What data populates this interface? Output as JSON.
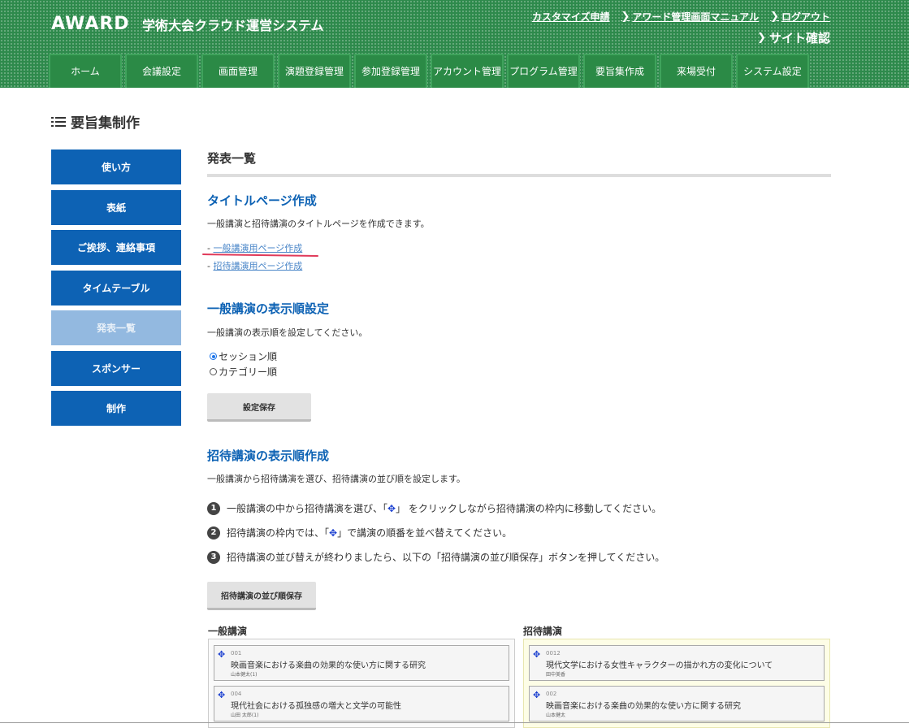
{
  "header": {
    "logo": "AWARD",
    "system_title": "学術大会クラウド運営システム",
    "links": [
      "カスタマイズ申請",
      "アワード管理画面マニュアル",
      "ログアウト"
    ],
    "site_check": "サイト確認",
    "nav": [
      "ホーム",
      "会議設定",
      "画面管理",
      "演題登録管理",
      "参加登録管理",
      "アカウント管理",
      "プログラム管理",
      "要旨集作成",
      "来場受付",
      "システム設定"
    ]
  },
  "page_title": "要旨集制作",
  "sidebar": {
    "items": [
      "使い方",
      "表紙",
      "ご挨拶、連絡事項",
      "タイムテーブル",
      "発表一覧",
      "スポンサー",
      "制作"
    ],
    "active": "発表一覧"
  },
  "main": {
    "section_title": "発表一覧",
    "title_page": {
      "heading": "タイトルページ作成",
      "desc": "一般講演と招待講演のタイトルページを作成できます。",
      "links": [
        "一般講演用ページ作成",
        "招待講演用ページ作成"
      ]
    },
    "order_setting": {
      "heading": "一般講演の表示順設定",
      "desc": "一般講演の表示順を設定してください。",
      "options": [
        "セッション順",
        "カテゴリー順"
      ],
      "selected": "セッション順",
      "save_button": "設定保存"
    },
    "invited": {
      "heading": "招待講演の表示順作成",
      "desc": "一般講演から招待講演を選び、招待講演の並び順を設定します。",
      "steps": [
        {
          "num": "1",
          "before": "一般講演の中から招待講演を選び、「",
          "after": "」 をクリックしながら招待講演の枠内に移動してください。"
        },
        {
          "num": "2",
          "before": "招待講演の枠内では、「",
          "after": "」で講演の順番を並べ替えてください。"
        },
        {
          "num": "3",
          "before": "招待講演の並び替えが終わりましたら、以下の「招待講演の並び順保存」ボタンを押してください。",
          "after": ""
        }
      ],
      "save_button": "招待講演の並び順保存",
      "general_heading": "一般講演",
      "invited_heading": "招待講演",
      "general_list": [
        {
          "id": "001",
          "title": "映画音楽における楽曲の効果的な使い方に関する研究",
          "author": "山本健太(1)"
        },
        {
          "id": "004",
          "title": "現代社会における孤独感の増大と文学の可能性",
          "author": "山田 太郎(1)"
        }
      ],
      "invited_list": [
        {
          "id": "0012",
          "title": "現代文学における女性キャラクターの描かれ方の変化について",
          "author": "田中美香"
        },
        {
          "id": "002",
          "title": "映画音楽における楽曲の効果的な使い方に関する研究",
          "author": "山本健太"
        }
      ]
    }
  },
  "colors": {
    "header_green": "#2e8a4c",
    "sidebar_blue": "#0d62b4",
    "sidebar_active": "#93b9e0",
    "heading_blue": "#0d62b4",
    "annotation_red": "#e03a5a"
  },
  "icons": {
    "move": "move-cross-icon",
    "list": "list-icon",
    "chevron": "chevron-right-icon"
  }
}
